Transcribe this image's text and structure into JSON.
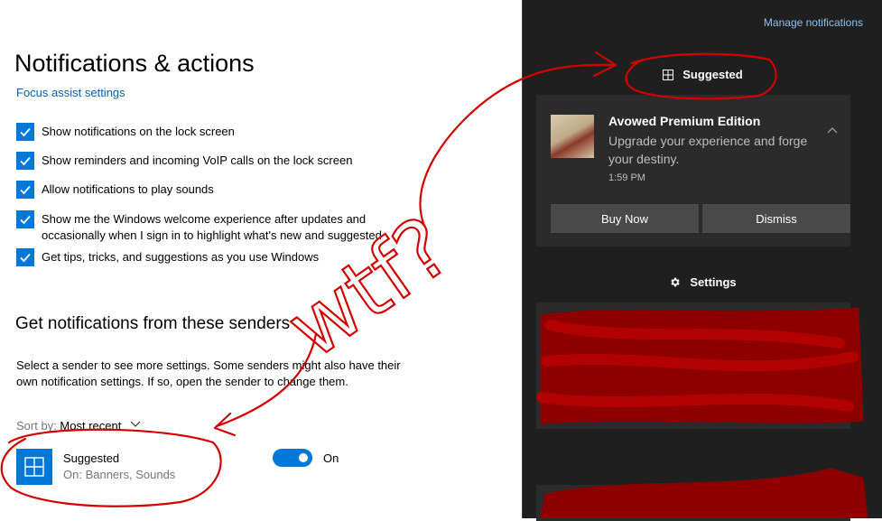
{
  "settings": {
    "title": "Notifications & actions",
    "focus_link": "Focus assist settings",
    "checkboxes": [
      {
        "label": "Show notifications on the lock screen",
        "checked": true
      },
      {
        "label": "Show reminders and incoming VoIP calls on the lock screen",
        "checked": true
      },
      {
        "label": "Allow notifications to play sounds",
        "checked": true
      },
      {
        "label": "Show me the Windows welcome experience after updates and occasionally when I sign in to highlight what's new and suggested",
        "checked": true
      },
      {
        "label": "Get tips, tricks, and suggestions as you use Windows",
        "checked": true
      }
    ],
    "senders_title": "Get notifications from these senders",
    "senders_desc": "Select a sender to see more settings. Some senders might also have their own notification settings. If so, open the sender to change them.",
    "sort_label": "Sort by:",
    "sort_value": "Most recent",
    "sender": {
      "name": "Suggested",
      "sub": "On: Banners, Sounds",
      "toggle_label": "On",
      "toggle_on": true
    }
  },
  "action_center": {
    "manage": "Manage notifications",
    "group_suggested": "Suggested",
    "toast": {
      "title": "Avowed Premium Edition",
      "body": "Upgrade your experience and forge your destiny.",
      "time": "1:59 PM",
      "buy": "Buy Now",
      "dismiss": "Dismiss"
    },
    "group_settings": "Settings"
  },
  "annotation": {
    "text": "wtf?",
    "color": "#d40000"
  }
}
